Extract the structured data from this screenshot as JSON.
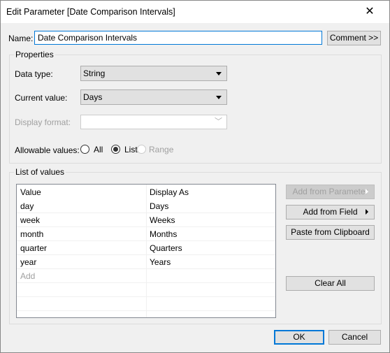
{
  "window": {
    "title": "Edit Parameter [Date Comparison Intervals]",
    "close_icon": "close-icon"
  },
  "name": {
    "label": "Name:",
    "value": "Date Comparison Intervals",
    "comment_button": "Comment >>"
  },
  "properties": {
    "title": "Properties",
    "data_type": {
      "label": "Data type:",
      "value": "String"
    },
    "current_value": {
      "label": "Current value:",
      "value": "Days"
    },
    "display_format": {
      "label": "Display format:",
      "value": "",
      "disabled": true
    },
    "allowable_values": {
      "label": "Allowable values:",
      "options": [
        "All",
        "List",
        "Range"
      ],
      "selected": "List",
      "disabled": [
        "Range"
      ]
    }
  },
  "list_of_values": {
    "title": "List of values",
    "headers": [
      "Value",
      "Display As"
    ],
    "rows": [
      [
        "day",
        "Days"
      ],
      [
        "week",
        "Weeks"
      ],
      [
        "month",
        "Months"
      ],
      [
        "quarter",
        "Quarters"
      ],
      [
        "year",
        "Years"
      ]
    ],
    "add_placeholder": "Add",
    "buttons": {
      "add_from_parameter": "Add from Parameter",
      "add_from_field": "Add from Field",
      "paste_from_clipboard": "Paste from Clipboard",
      "clear_all": "Clear All"
    }
  },
  "footer": {
    "ok": "OK",
    "cancel": "Cancel"
  },
  "colors": {
    "accent": "#0078d7"
  }
}
